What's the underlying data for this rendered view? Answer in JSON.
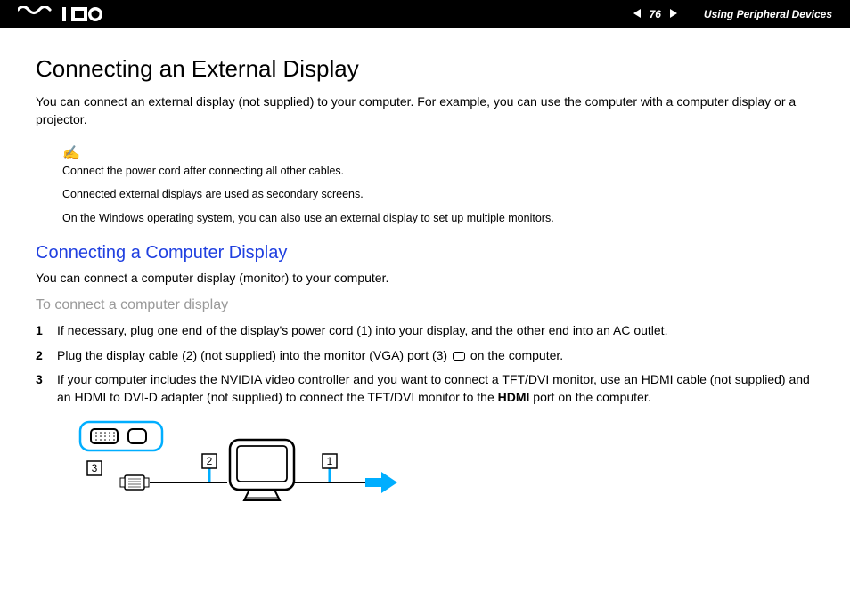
{
  "header": {
    "page_number": "76",
    "section": "Using Peripheral Devices"
  },
  "title": "Connecting an External Display",
  "intro": "You can connect an external display (not supplied) to your computer. For example, you can use the computer with a computer display or a projector.",
  "notes": {
    "line1": "Connect the power cord after connecting all other cables.",
    "line2": "Connected external displays are used as secondary screens.",
    "line3": "On the Windows operating system, you can also use an external display to set up multiple monitors."
  },
  "subsection_title": "Connecting a Computer Display",
  "subsection_intro": "You can connect a computer display (monitor) to your computer.",
  "procedure_title": "To connect a computer display",
  "steps": {
    "s1": "If necessary, plug one end of the display's power cord (1) into your display, and the other end into an AC outlet.",
    "s2_a": "Plug the display cable (2) (not supplied) into the monitor (VGA) port (3) ",
    "s2_b": " on the computer.",
    "s3_a": "If your computer includes the NVIDIA video controller and you want to connect a TFT/DVI monitor, use an HDMI cable (not supplied) and an HDMI to DVI-D adapter (not supplied) to connect the TFT/DVI monitor to the ",
    "s3_bold": "HDMI",
    "s3_b": " port on the computer."
  },
  "diagram_labels": {
    "l1": "1",
    "l2": "2",
    "l3": "3"
  }
}
